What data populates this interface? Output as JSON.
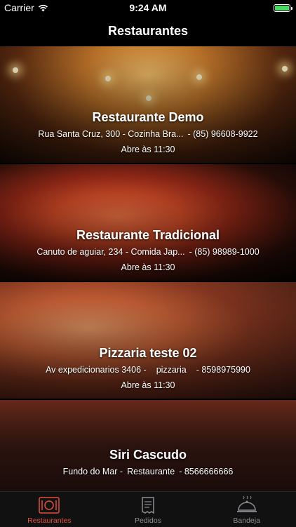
{
  "status_bar": {
    "carrier": "Carrier",
    "time": "9:24 AM"
  },
  "nav": {
    "title": "Restaurantes"
  },
  "restaurants": [
    {
      "name": "Restaurante Demo",
      "address": "Rua Santa Cruz, 300 - Cozinha Bra...",
      "phone": "- (85) 96608-9922",
      "hours": "Abre às 11:30"
    },
    {
      "name": "Restaurante Tradicional",
      "address": "Canuto de aguiar, 234 - Comida Jap...",
      "phone": "- (85) 98989-1000",
      "hours": "Abre às 11:30"
    },
    {
      "name": "Pizzaria teste 02",
      "address": "Av expedicionarios 3406 -",
      "category": "pizzaria",
      "phone": "- 8598975990",
      "hours": "Abre às 11:30"
    },
    {
      "name": "Siri Cascudo",
      "address": "Fundo do Mar -",
      "category": "Restaurante",
      "phone": "- 8566666666"
    }
  ],
  "tabs": [
    {
      "label": "Restaurantes",
      "icon": "plate-cutlery-icon",
      "active": true
    },
    {
      "label": "Pedidos",
      "icon": "receipt-icon",
      "active": false
    },
    {
      "label": "Bandeja",
      "icon": "cloche-icon",
      "active": false
    }
  ],
  "colors": {
    "accent": "#e2513c",
    "battery": "#4cd964"
  }
}
